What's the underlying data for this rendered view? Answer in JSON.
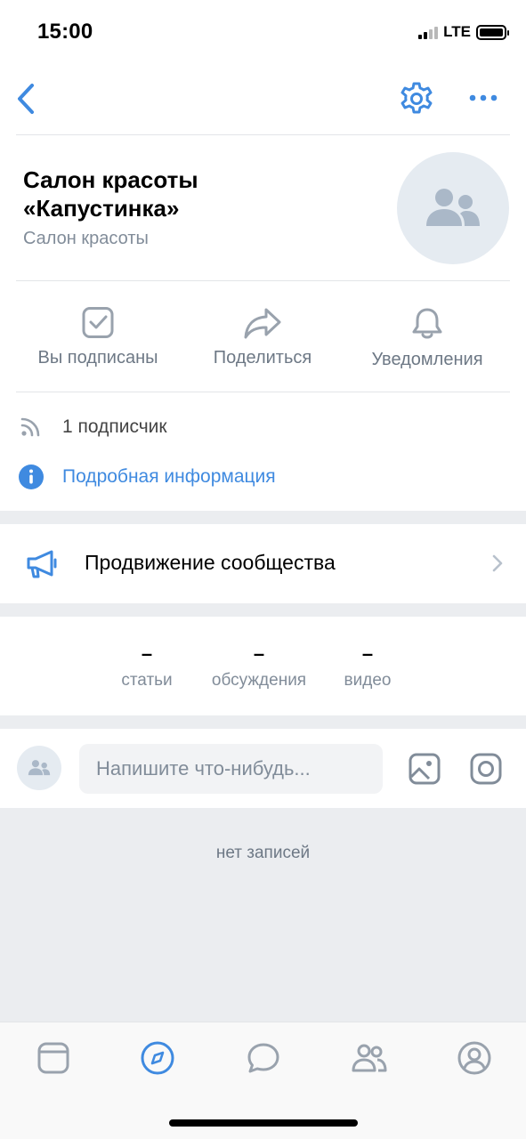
{
  "status_bar": {
    "time": "15:00",
    "network": "LTE"
  },
  "header": {
    "back_icon": "chevron-left-icon",
    "settings_icon": "gear-icon",
    "more_icon": "more-horizontal-icon"
  },
  "community": {
    "name": "Салон красоты «Капустинка»",
    "category": "Салон красоты",
    "avatar_icon": "users-icon"
  },
  "actions": [
    {
      "label": "Вы подписаны",
      "icon": "checkbox-checked-icon"
    },
    {
      "label": "Поделиться",
      "icon": "share-arrow-icon"
    },
    {
      "label": "Уведомления",
      "icon": "bell-icon"
    }
  ],
  "info": {
    "subscribers": "1 подписчик",
    "details_link": "Подробная информация"
  },
  "promotion": {
    "label": "Продвижение сообщества",
    "icon": "megaphone-icon"
  },
  "counters": [
    {
      "value": "–",
      "label": "статьи"
    },
    {
      "value": "–",
      "label": "обсуждения"
    },
    {
      "value": "–",
      "label": "видео"
    }
  ],
  "composer": {
    "placeholder": "Напишите что-нибудь..."
  },
  "feed": {
    "empty_text": "нет записей"
  },
  "tabbar": {
    "items": [
      "news-icon",
      "discover-icon",
      "messages-icon",
      "friends-icon",
      "profile-icon"
    ],
    "active": "discover-icon"
  },
  "colors": {
    "accent": "#3f8ae0",
    "secondary_text": "#818c99",
    "icon_gray": "#99a2ad",
    "separator": "#ebedf0"
  }
}
